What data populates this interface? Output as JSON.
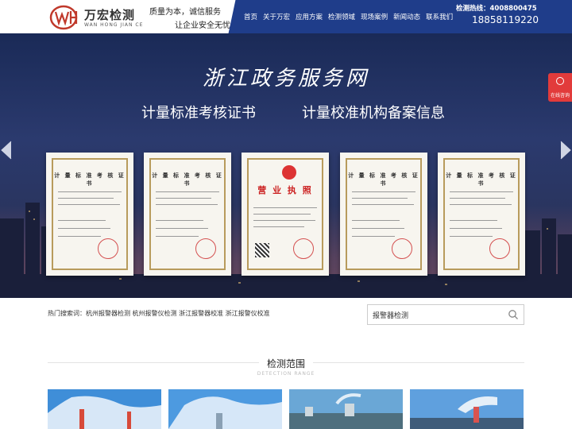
{
  "header": {
    "logo_cn": "万宏检测",
    "logo_en": "WAN HONG JIAN CE",
    "slogan_line1": "质量为本，诚信服务",
    "slogan_line2": "让企业安全无忧",
    "nav": [
      "首页",
      "关于万宏",
      "应用方案",
      "检测领域",
      "现场案例",
      "新闻动态",
      "联系我们"
    ],
    "hotline_label": "检测热线：4008800475",
    "hotline_phone": "18858119220"
  },
  "banner": {
    "title": "浙江政务服务网",
    "subtitle_left": "计量标准考核证书",
    "subtitle_right": "计量校准机构备案信息",
    "cert_title": "计 量 标 准 考 核 证 书",
    "license_title": "营 业 执 照"
  },
  "float_consult": {
    "label": "在线咨询"
  },
  "search": {
    "hot_label": "热门搜索词：",
    "hot_words": [
      "杭州报警器检测",
      "杭州报警仪检测",
      "浙江报警器校准",
      "浙江报警仪校准"
    ],
    "input_value": "报警器检测"
  },
  "section": {
    "title": "检测范围",
    "subtitle": "DETECTION RANGE"
  },
  "colors": {
    "nav_bg": "#1f3d8a",
    "accent_red": "#e23b3b"
  }
}
